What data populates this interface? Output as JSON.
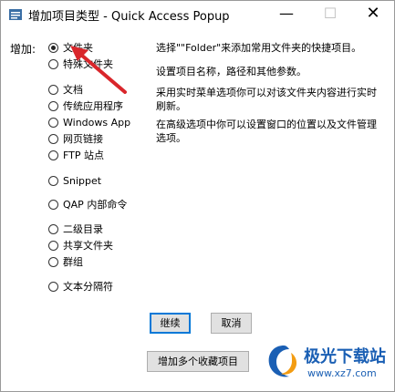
{
  "window": {
    "title": "增加项目类型 - Quick Access Popup",
    "minimize_glyph": "—",
    "maximize_glyph": "☐",
    "close_glyph": "✕"
  },
  "add_label": "增加:",
  "options": [
    {
      "label": "文件夹",
      "checked": true
    },
    {
      "label": "特殊文件夹",
      "checked": false
    },
    {
      "label": "文档",
      "checked": false
    },
    {
      "label": "传统应用程序",
      "checked": false
    },
    {
      "label": "Windows App",
      "checked": false
    },
    {
      "label": "网页链接",
      "checked": false
    },
    {
      "label": "FTP 站点",
      "checked": false
    },
    {
      "label": "Snippet",
      "checked": false
    },
    {
      "label": "QAP 内部命令",
      "checked": false
    },
    {
      "label": "二级目录",
      "checked": false
    },
    {
      "label": "共享文件夹",
      "checked": false
    },
    {
      "label": "群组",
      "checked": false
    },
    {
      "label": "文本分隔符",
      "checked": false
    }
  ],
  "description": {
    "p1": "选择\"\"Folder\"来添加常用文件夹的快捷项目。",
    "p2": "设置项目名称，路径和其他参数。",
    "p3": "采用实时菜单选项你可以对该文件夹内容进行实时刷新。",
    "p4": "在高级选项中你可以设置窗口的位置以及文件管理选项。"
  },
  "buttons": {
    "continue": "继续",
    "cancel": "取消",
    "add_multiple": "增加多个收藏项目"
  },
  "watermark": {
    "name": "极光下载站",
    "url": "www.xz7.com"
  },
  "colors": {
    "arrow": "#d9262b",
    "default_button_border": "#0078d7",
    "watermark": "#1a5fb4"
  }
}
